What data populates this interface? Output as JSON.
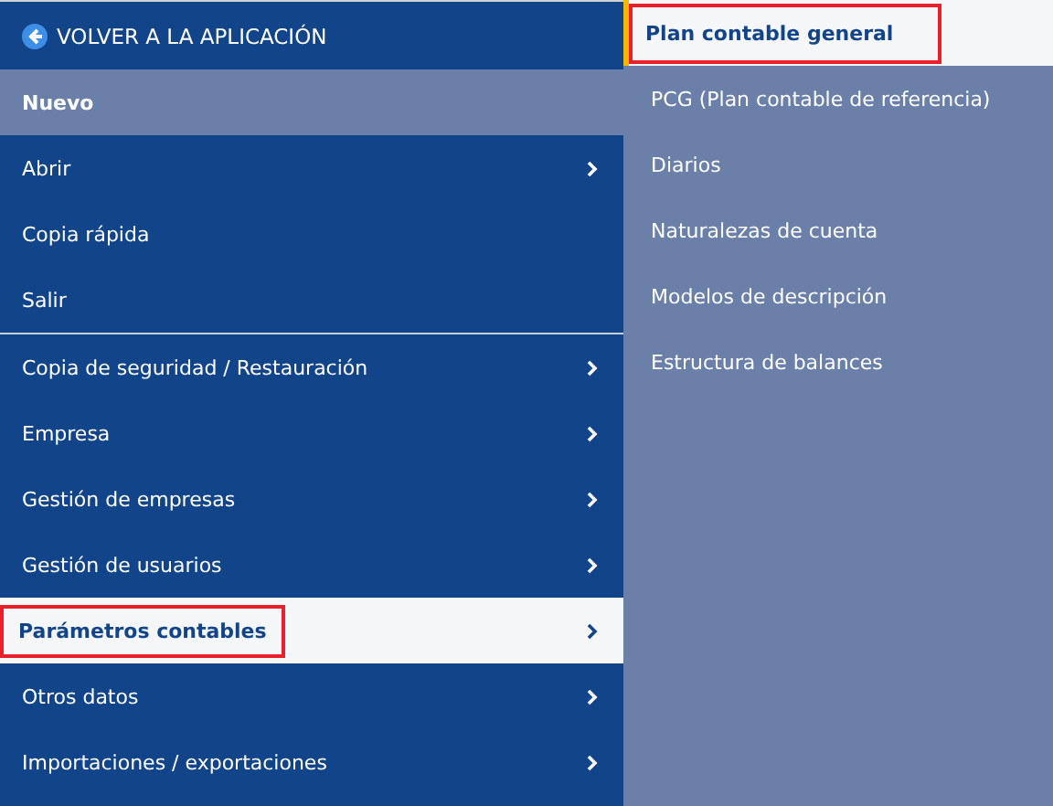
{
  "back_button": {
    "label": "VOLVER A LA APLICACIÓN"
  },
  "menu": [
    {
      "label": "Nuevo",
      "selected": false,
      "hovered": true,
      "submenu": false,
      "marked": false,
      "separator_after": false
    },
    {
      "label": "Abrir",
      "selected": false,
      "hovered": false,
      "submenu": true,
      "marked": false,
      "separator_after": false
    },
    {
      "label": "Copia rápida",
      "selected": false,
      "hovered": false,
      "submenu": false,
      "marked": false,
      "separator_after": false
    },
    {
      "label": "Salir",
      "selected": false,
      "hovered": false,
      "submenu": false,
      "marked": false,
      "separator_after": true
    },
    {
      "label": "Copia de seguridad / Restauración",
      "selected": false,
      "hovered": false,
      "submenu": true,
      "marked": false,
      "separator_after": false
    },
    {
      "label": "Empresa",
      "selected": false,
      "hovered": false,
      "submenu": true,
      "marked": false,
      "separator_after": false
    },
    {
      "label": "Gestión de empresas",
      "selected": false,
      "hovered": false,
      "submenu": true,
      "marked": false,
      "separator_after": false
    },
    {
      "label": "Gestión de usuarios",
      "selected": false,
      "hovered": false,
      "submenu": true,
      "marked": false,
      "separator_after": false
    },
    {
      "label": "Parámetros contables",
      "selected": true,
      "hovered": false,
      "submenu": true,
      "marked": true,
      "separator_after": false
    },
    {
      "label": "Otros datos",
      "selected": false,
      "hovered": false,
      "submenu": true,
      "marked": false,
      "separator_after": false
    },
    {
      "label": "Importaciones / exportaciones",
      "selected": false,
      "hovered": false,
      "submenu": true,
      "marked": false,
      "separator_after": false
    }
  ],
  "submenu": [
    {
      "label": "Plan contable general",
      "selected": true,
      "marked": true
    },
    {
      "label": "PCG (Plan contable de referencia)",
      "selected": false,
      "marked": false
    },
    {
      "label": "Diarios",
      "selected": false,
      "marked": false
    },
    {
      "label": "Naturalezas de cuenta",
      "selected": false,
      "marked": false
    },
    {
      "label": "Modelos de descripción",
      "selected": false,
      "marked": false
    },
    {
      "label": "Estructura de balances",
      "selected": false,
      "marked": false
    }
  ]
}
